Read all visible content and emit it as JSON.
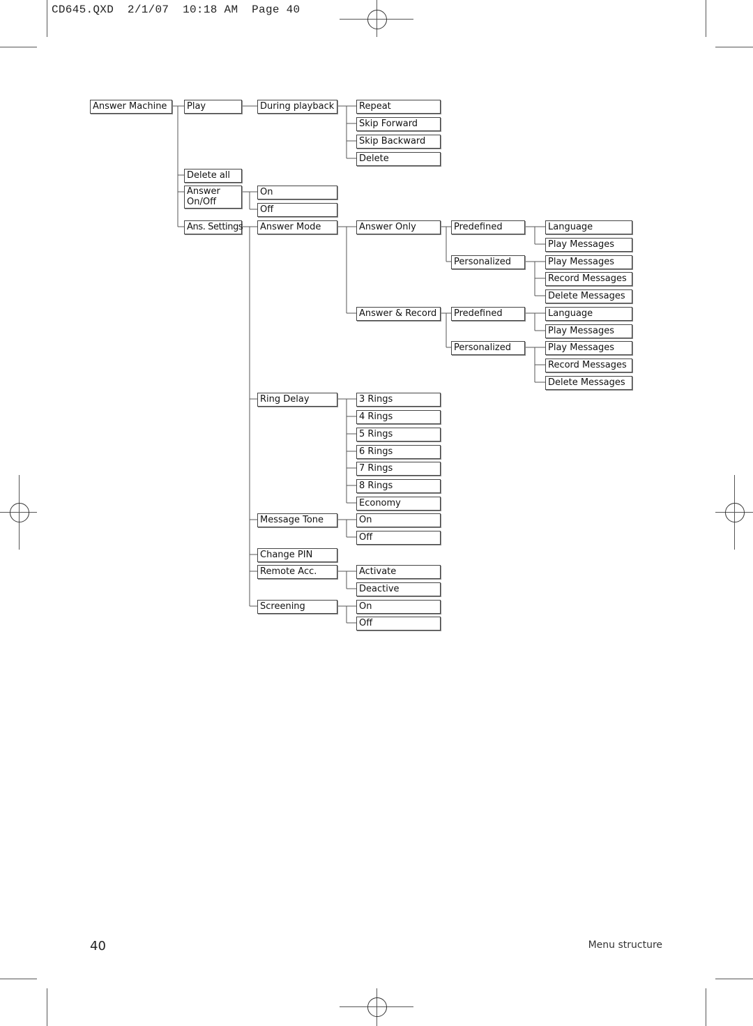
{
  "slug_line": "CD645.QXD  2/1/07  10:18 AM  Page 40",
  "footer": {
    "page_number": "40",
    "section_title": "Menu structure"
  },
  "menu": {
    "root": "Answer Machine",
    "level1": {
      "play": "Play",
      "delete_all": "Delete all",
      "answer_onoff": "Answer On/Off",
      "ans_settings": "Ans. Settings"
    },
    "play": {
      "during_playback": "During playback",
      "options": [
        "Repeat",
        "Skip Forward",
        "Skip Backward",
        "Delete"
      ]
    },
    "answer_onoff": {
      "options": [
        "On",
        "Off"
      ]
    },
    "ans_settings": {
      "answer_mode": "Answer Mode",
      "ring_delay": "Ring Delay",
      "message_tone": "Message Tone",
      "change_pin": "Change PIN",
      "remote_acc": "Remote Acc.",
      "screening": "Screening"
    },
    "answer_mode": {
      "answer_only": "Answer Only",
      "answer_record": "Answer & Record",
      "predefined": "Predefined",
      "personalized": "Personalized",
      "predefined_options": [
        "Language",
        "Play Messages"
      ],
      "personalized_options": [
        "Play Messages",
        "Record Messages",
        "Delete Messages"
      ]
    },
    "ring_delay": {
      "options": [
        "3 Rings",
        "4 Rings",
        "5 Rings",
        "6 Rings",
        "7 Rings",
        "8 Rings",
        "Economy"
      ]
    },
    "message_tone": {
      "options": [
        "On",
        "Off"
      ]
    },
    "remote_acc": {
      "options": [
        "Activate",
        "Deactive"
      ]
    },
    "screening": {
      "options": [
        "On",
        "Off"
      ]
    }
  }
}
